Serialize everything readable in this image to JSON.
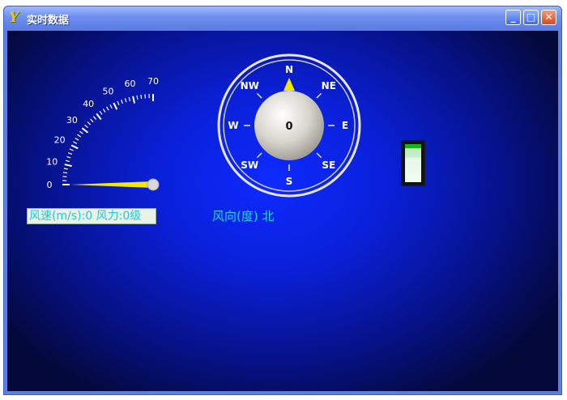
{
  "window": {
    "title": "实时数据",
    "app_icon_glyph": "Y",
    "minimize_glyph": "_",
    "maximize_glyph": "□",
    "close_glyph": "✕"
  },
  "speed_gauge": {
    "ticks": [
      "0",
      "10",
      "20",
      "30",
      "40",
      "50",
      "60",
      "70"
    ],
    "min": 0,
    "max": 70,
    "value": 0,
    "needle_color": "#f5e600"
  },
  "speed_label": "风速(m/s):0   风力:0级",
  "compass": {
    "directions": [
      "N",
      "NE",
      "E",
      "SE",
      "S",
      "SW",
      "W",
      "NW"
    ],
    "center_value": "0",
    "pointer_color": "#f5e600"
  },
  "direction_label": "风向(度) 北",
  "indicator": {
    "level": 0.1,
    "bar_color": "#19b219"
  }
}
